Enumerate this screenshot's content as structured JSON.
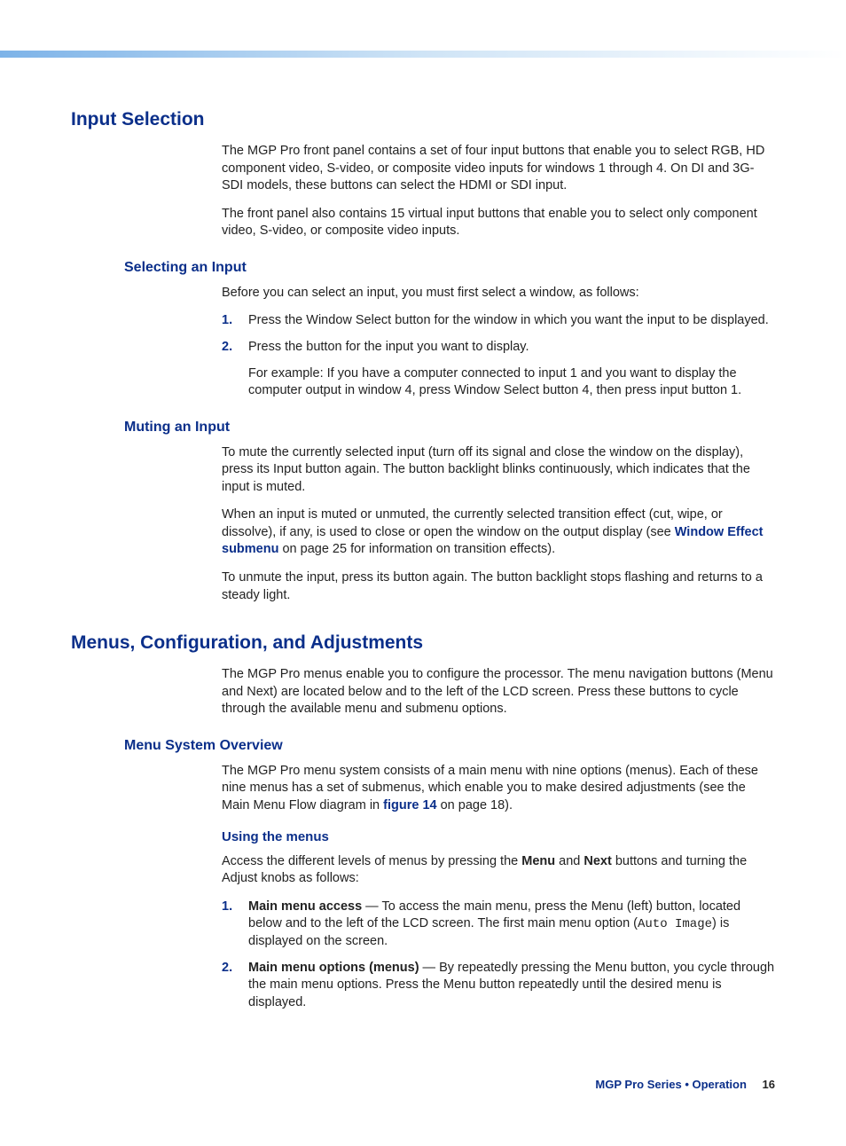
{
  "sections": {
    "input_selection": {
      "title": "Input Selection",
      "p1": "The MGP Pro front panel contains a set of four input buttons that enable you to select RGB, HD component video, S-video, or composite video inputs for windows 1 through 4. On DI and 3G-SDI models, these buttons can select the HDMI or SDI input.",
      "p2": "The front panel also contains 15 virtual input buttons that enable you to select only component video, S-video, or composite video inputs.",
      "selecting": {
        "title": "Selecting an Input",
        "intro": "Before you can select an input, you must first select a window, as follows:",
        "step1_num": "1.",
        "step1": "Press the Window Select button for the window in which you want the input to be displayed.",
        "step2_num": "2.",
        "step2": "Press the button for the input you want to display.",
        "step2_example": "For example: If you have a computer connected to input 1 and you want to display the computer output in window 4, press Window Select button 4, then press input button 1."
      },
      "muting": {
        "title": "Muting an Input",
        "p1": "To mute the currently selected input (turn off its signal and close the window on the display), press its Input button again. The button backlight blinks continuously, which indicates that the input is muted.",
        "p2_a": "When an input is muted or unmuted, the currently selected transition effect (cut, wipe, or dissolve), if any, is used to close or open the window on the output display (see ",
        "p2_link": "Window Effect submenu",
        "p2_b": " on page 25 for information on transition effects).",
        "p3": "To unmute the input, press its button again. The button backlight stops flashing and returns to a steady light."
      }
    },
    "menus": {
      "title": "Menus, Configuration, and Adjustments",
      "p1": "The MGP Pro menus enable you to configure the processor. The menu navigation buttons (Menu and Next) are located below and to the left of the LCD screen. Press these buttons to cycle through the available menu and submenu options.",
      "overview": {
        "title": "Menu System Overview",
        "p1_a": "The MGP Pro menu system consists of a main menu with nine options (menus). Each of these nine menus has a set of submenus, which enable you to make desired adjustments (see the Main Menu Flow diagram in ",
        "p1_link": "figure 14",
        "p1_b": " on page 18).",
        "using": {
          "title": "Using the menus",
          "intro_a": "Access the different levels of menus by pressing the ",
          "intro_menu": "Menu",
          "intro_and": " and ",
          "intro_next": "Next",
          "intro_b": " buttons and turning the Adjust knobs as follows:",
          "step1_num": "1.",
          "step1_label": "Main menu access",
          "step1_a": " — To access the main menu, press the Menu (left) button, located below and to the left of the LCD screen. The first main menu option (",
          "step1_mono": "Auto Image",
          "step1_b": ") is displayed on the screen.",
          "step2_num": "2.",
          "step2_label": "Main menu options (menus)",
          "step2": " — By repeatedly pressing the Menu button, you cycle through the main menu options. Press the Menu button repeatedly until the desired menu is displayed."
        }
      }
    }
  },
  "footer": {
    "title": "MGP Pro Series • Operation",
    "page": "16"
  }
}
